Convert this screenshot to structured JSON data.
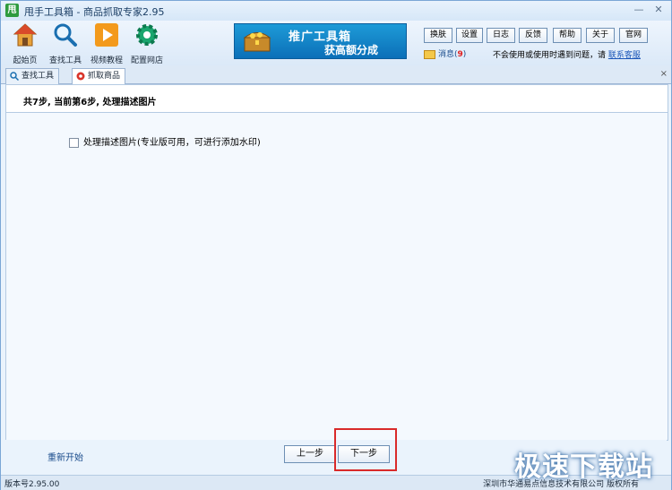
{
  "window": {
    "logo_text": "甩",
    "title": "甩手工具箱 - 商品抓取专家2.95",
    "minimize": "—",
    "close": "✕"
  },
  "toolbar": {
    "tools": [
      {
        "label": "起始页",
        "icon": "house-icon"
      },
      {
        "label": "查找工具",
        "icon": "magnifier-icon"
      },
      {
        "label": "视频教程",
        "icon": "play-icon"
      },
      {
        "label": "配置网店",
        "icon": "gear-icon"
      }
    ],
    "banner": {
      "line1": "推广工具箱",
      "line2": "获高额分成"
    },
    "buttons": [
      "换肤",
      "设置",
      "日志",
      "反馈",
      "帮助",
      "关于",
      "官网"
    ],
    "message": {
      "label": "消息(",
      "count": "9",
      "suffix": ")"
    },
    "help_text": "不会使用或使用时遇到问题，请",
    "help_link": "联系客服"
  },
  "tabs": [
    {
      "label": "查找工具",
      "icon": "search-icon",
      "active": false
    },
    {
      "label": "抓取商品",
      "icon": "grab-icon",
      "active": true
    }
  ],
  "tab_close": "×",
  "content": {
    "step_text": "共7步, 当前第6步, 处理描述图片",
    "checkbox_label": "处理描述图片(专业版可用，可进行添加水印)"
  },
  "bottom": {
    "restart": "重新开始",
    "prev": "上一步",
    "next": "下一步"
  },
  "status": {
    "version": "版本号2.95.00",
    "copyright": "深圳市华通易点信息技术有限公司 版权所有"
  },
  "watermark": "极速下载站"
}
